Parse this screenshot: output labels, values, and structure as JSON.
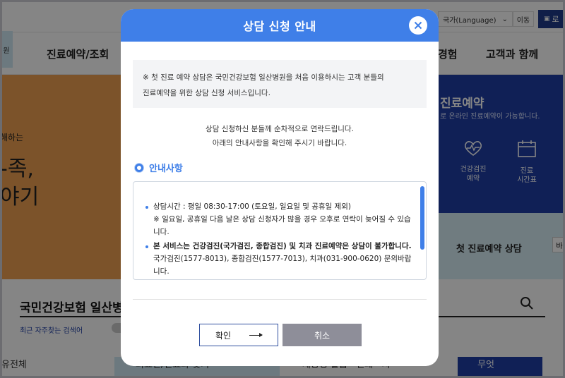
{
  "page": {
    "lang_select": "국가(Language)",
    "lang_go": "이동",
    "login": "로",
    "side_tab": "원",
    "gnb": {
      "item1": "진료예약/조회",
      "item2": "경험",
      "item3": "고객과 함께"
    },
    "hero": {
      "line1": "해하는",
      "line2": "-족,",
      "line3": "야기"
    },
    "blue_panel": {
      "title": "진료예약",
      "subtitle": "로 온라인 진료예약이 가능합니다.",
      "icon1_label": "건강검진\n예약",
      "icon2_label": "진료\n시간표"
    },
    "light_panel": {
      "label": "첫 진료예약 상담",
      "arrow": "바"
    },
    "search": {
      "title": "국민건강보험 일산병원",
      "recent": "최근 자주찾는 검색어"
    },
    "bottom_cards": [
      "유전체",
      "의료진/진료과 찾기",
      "제증명 발급 · 인쇄 · 지",
      "무엇"
    ]
  },
  "modal": {
    "title": "상담 신청 안내",
    "notice_line1": "※ 첫 진료 예약 상담은 국민건강보험 일산병원을 처음 이용하시는 고객 분들의",
    "notice_line2": "진료예약을 위한 상담 신청 서비스입니다.",
    "center_line1": "상담 신청하신 분들께 순차적으로 연락드립니다.",
    "center_line2": "아래의 안내사항을 확인해 주시기 바랍니다.",
    "info_heading": "안내사항",
    "bullets": [
      {
        "main": "상담시간 : 평일 08:30-17:00 (토요일, 일요일 및 공휴일 제외)",
        "note": "※ 일요일, 공휴일 다음 날은 상담 신청자가 많을 경우 오후로 연락이 늦어질 수 있습니다."
      },
      {
        "main": "본 서비스는 건강검진(국가검진, 종합검진) 및 치과 진료예약은 상담이 불가합니다.",
        "note": "국가검진(1577-8013), 종합검진(1577-7013), 치과(031-900-0620) 문의바랍니다."
      }
    ],
    "confirm_label": "확인",
    "cancel_label": "취소"
  }
}
